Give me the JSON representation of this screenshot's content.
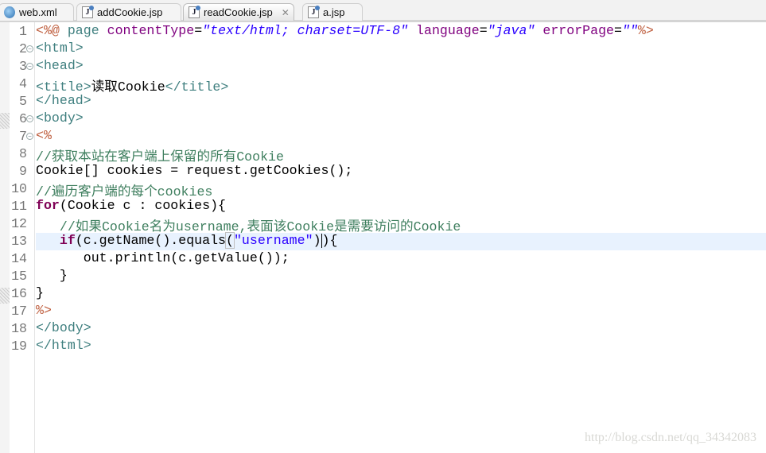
{
  "tabs": [
    {
      "label": "web.xml",
      "icon": "web-xml-icon",
      "active": false
    },
    {
      "label": "addCookie.jsp",
      "icon": "jsp-file-icon",
      "active": false
    },
    {
      "label": "readCookie.jsp",
      "icon": "jsp-file-icon",
      "active": true,
      "close": "✕"
    },
    {
      "label": "a.jsp",
      "icon": "jsp-file-icon",
      "active": false
    }
  ],
  "fold_lines": [
    2,
    3,
    6,
    7
  ],
  "current_line": 13,
  "lines": [
    [
      [
        "jd",
        "<%@ "
      ],
      [
        "tag",
        "page "
      ],
      [
        "an",
        "contentType"
      ],
      [
        "pl",
        "="
      ],
      [
        "av",
        "\"text/html; charset=UTF-8\""
      ],
      [
        "pl",
        " "
      ],
      [
        "an",
        "language"
      ],
      [
        "pl",
        "="
      ],
      [
        "av",
        "\"java\""
      ],
      [
        "pl",
        " "
      ],
      [
        "an",
        "errorPage"
      ],
      [
        "pl",
        "="
      ],
      [
        "av",
        "\"\""
      ],
      [
        "jd",
        "%>"
      ]
    ],
    [
      [
        "tag",
        "<html>"
      ]
    ],
    [
      [
        "tag",
        "<head>"
      ]
    ],
    [
      [
        "tag",
        "<title>"
      ],
      [
        "pl",
        "读取Cookie"
      ],
      [
        "tag",
        "</title>"
      ]
    ],
    [
      [
        "tag",
        "</head>"
      ]
    ],
    [
      [
        "tag",
        "<body>"
      ]
    ],
    [
      [
        "jd",
        "<%"
      ]
    ],
    [
      [
        "cm",
        "//获取本站在客户端上保留的所有Cookie"
      ]
    ],
    [
      [
        "pl",
        "Cookie[] cookies = request.getCookies();"
      ]
    ],
    [
      [
        "cm",
        "//遍历客户端的每个cookies"
      ]
    ],
    [
      [
        "kw",
        "for"
      ],
      [
        "pl",
        "(Cookie c : cookies){"
      ]
    ],
    [
      [
        "pl",
        "   "
      ],
      [
        "cm",
        "//如果Cookie名为username,表面该Cookie是需要访问的Cookie"
      ]
    ],
    [
      [
        "pl",
        "   "
      ],
      [
        "kw",
        "if"
      ],
      [
        "pl",
        "(c.getName().equals"
      ],
      [
        "bm",
        "("
      ],
      [
        "st",
        "\"username\""
      ],
      [
        "pl",
        ")"
      ],
      [
        "caret",
        ""
      ],
      [
        "pl",
        "){"
      ]
    ],
    [
      [
        "pl",
        "      out.println(c.getValue());"
      ]
    ],
    [
      [
        "pl",
        "   }"
      ]
    ],
    [
      [
        "pl",
        "}"
      ]
    ],
    [
      [
        "jd",
        "%>"
      ]
    ],
    [
      [
        "tag",
        "</body>"
      ]
    ],
    [
      [
        "tag",
        "</html>"
      ]
    ]
  ],
  "watermark": "http://blog.csdn.net/qq_34342083"
}
